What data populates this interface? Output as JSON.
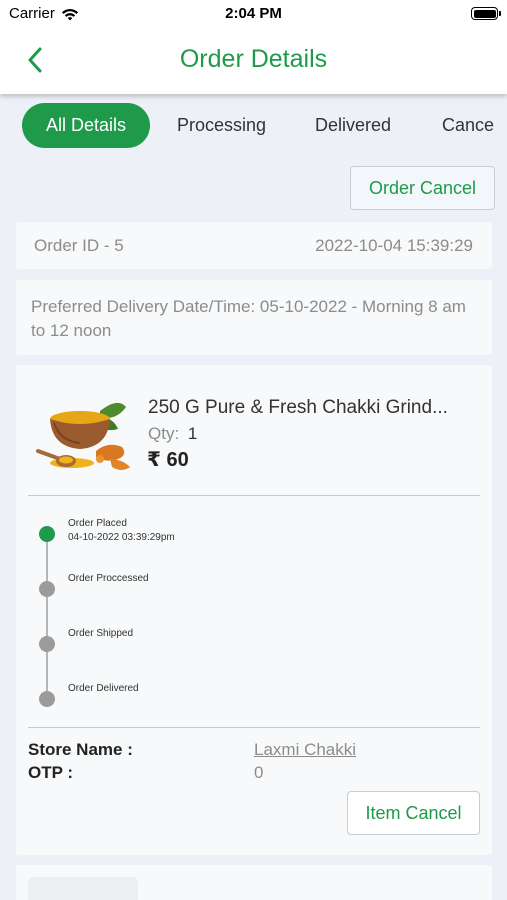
{
  "status_bar": {
    "carrier": "Carrier",
    "time": "2:04 PM"
  },
  "header": {
    "title": "Order Details",
    "back_icon": "chevron-left-icon"
  },
  "tabs": [
    {
      "label": "All Details",
      "active": true
    },
    {
      "label": "Processing",
      "active": false
    },
    {
      "label": "Delivered",
      "active": false
    },
    {
      "label": "Cance",
      "active": false
    }
  ],
  "order_cancel_label": "Order Cancel",
  "order": {
    "id_label": "Order ID - 5",
    "datetime": "2022-10-04 15:39:29",
    "preferred_delivery": "Preferred Delivery Date/Time: 05-10-2022 - Morning 8 am to 12 noon"
  },
  "item": {
    "name": "250 G Pure & Fresh Chakki Grind...",
    "qty_label": "Qty:",
    "qty_value": "1",
    "price": "₹ 60",
    "timeline": [
      {
        "label": "Order Placed",
        "sub": "04-10-2022 03:39:29pm",
        "done": true
      },
      {
        "label": "Order Proccessed",
        "sub": "",
        "done": false
      },
      {
        "label": "Order Shipped",
        "sub": "",
        "done": false
      },
      {
        "label": "Order Delivered",
        "sub": "",
        "done": false
      }
    ],
    "store_label": "Store Name :",
    "store_value": "Laxmi Chakki",
    "otp_label": "OTP :",
    "otp_value": "0",
    "cancel_label": "Item Cancel"
  },
  "colors": {
    "accent": "#1f9a4b",
    "background": "#edf1f7",
    "muted_text": "#8c8c8c"
  }
}
